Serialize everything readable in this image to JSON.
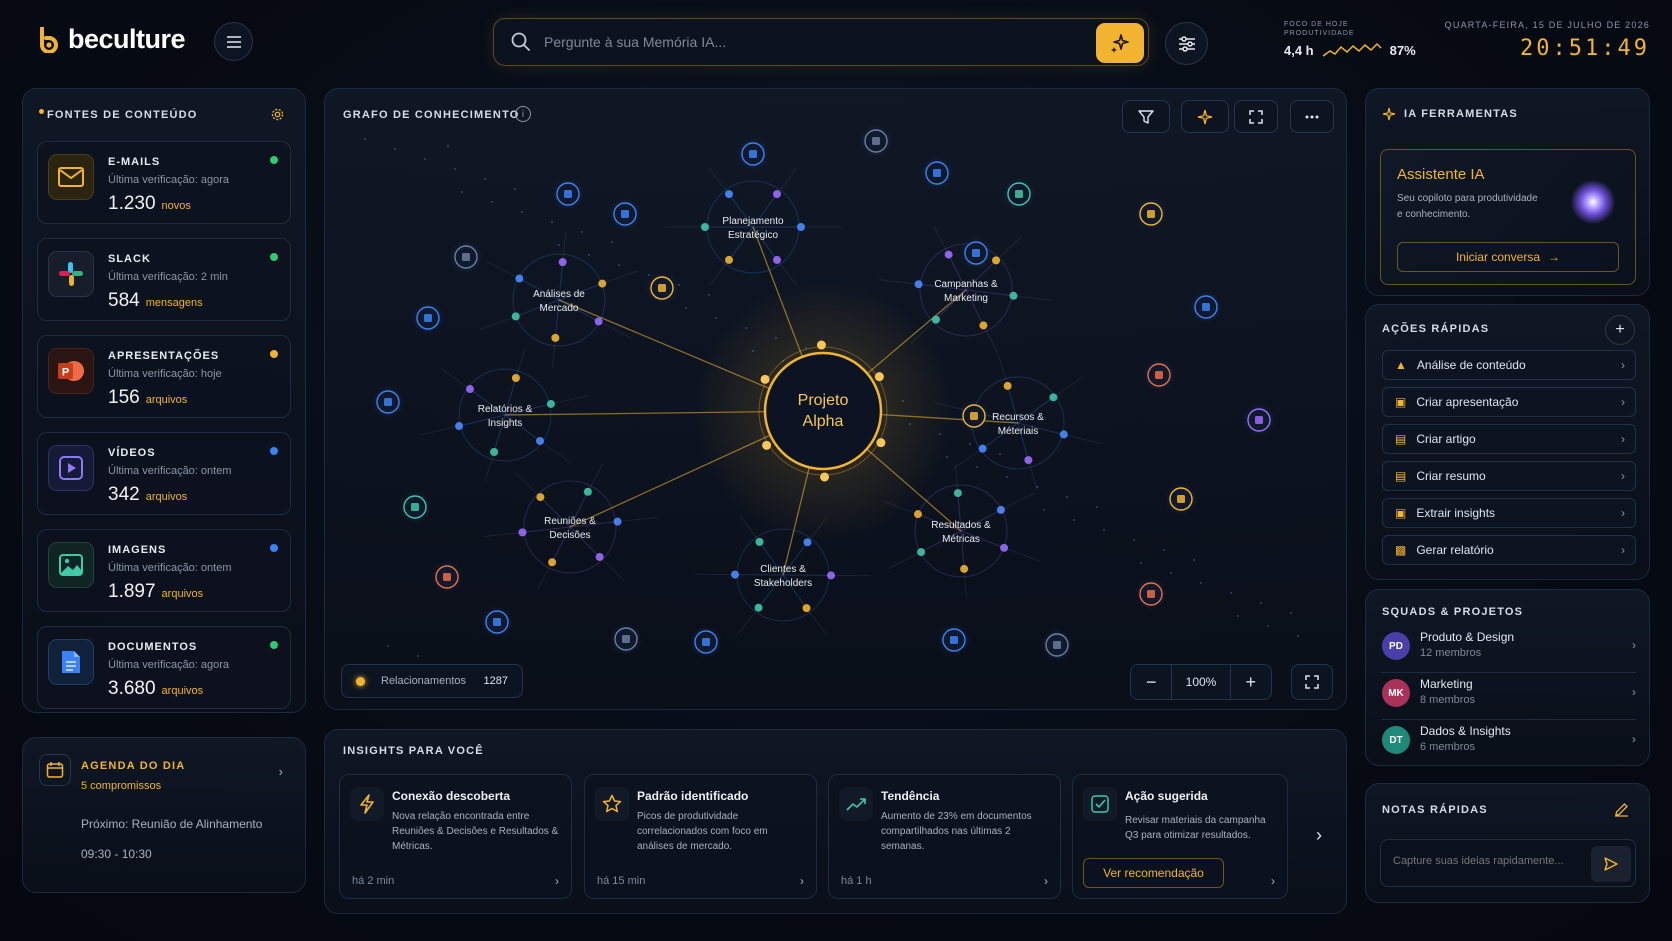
{
  "brand": {
    "name": "beculture"
  },
  "search": {
    "placeholder": "Pergunte à sua Memória IA..."
  },
  "focus": {
    "label_line1": "FOCO DE HOJE",
    "label_line2": "PRODUTIVIDADE",
    "hours": "4,4 h",
    "percent": "87%"
  },
  "datetime": {
    "date": "QUARTA-FEIRA, 15 DE JULHO DE 2026",
    "time": "20:51:49"
  },
  "sources": {
    "title": "FONTES DE CONTEÚDO",
    "items": [
      {
        "name": "E-MAILS",
        "check": "Última verificação: agora",
        "count": "1.230",
        "unit": "novos",
        "dot": "#2ecc71",
        "icon": "mail-icon"
      },
      {
        "name": "SLACK",
        "check": "Última verificação: 2 min",
        "count": "584",
        "unit": "mensagens",
        "dot": "#2ecc71",
        "icon": "slack-icon"
      },
      {
        "name": "APRESENTAÇÕES",
        "check": "Última verificação: hoje",
        "count": "156",
        "unit": "arquivos",
        "dot": "#f2b430",
        "icon": "powerpoint-icon"
      },
      {
        "name": "VÍDEOS",
        "check": "Última verificação: ontem",
        "count": "342",
        "unit": "arquivos",
        "dot": "#3b82f6",
        "icon": "video-icon"
      },
      {
        "name": "IMAGENS",
        "check": "Última verificação: ontem",
        "count": "1.897",
        "unit": "arquivos",
        "dot": "#3b82f6",
        "icon": "image-icon"
      },
      {
        "name": "DOCUMENTOS",
        "check": "Última verificação: agora",
        "count": "3.680",
        "unit": "arquivos",
        "dot": "#2ecc71",
        "icon": "document-icon"
      }
    ]
  },
  "agenda": {
    "title": "AGENDA DO DIA",
    "count": "5 compromissos",
    "next": "Próximo: Reunião de Alinhamento",
    "time": "09:30 - 10:30"
  },
  "graph": {
    "title": "GRAFO DE CONHECIMENTO",
    "center_line1": "Projeto",
    "center_line2": "Alpha",
    "clusters": [
      {
        "line1": "Planejamento",
        "line2": "Estratégico"
      },
      {
        "line1": "Análises de",
        "line2": "Mercado"
      },
      {
        "line1": "Campanhas &",
        "line2": "Marketing"
      },
      {
        "line1": "Relatórios &",
        "line2": "Insights"
      },
      {
        "line1": "Recursos &",
        "line2": "Méteriais"
      },
      {
        "line1": "Reuniões &",
        "line2": "Decisões"
      },
      {
        "line1": "Resultados &",
        "line2": "Métricas"
      },
      {
        "line1": "Clientes &",
        "line2": "Stakeholders"
      }
    ],
    "relationships_label": "Relacionamentos",
    "relationships_count": "1287",
    "zoom": "100%"
  },
  "insights": {
    "title": "INSIGHTS PARA VOCÊ",
    "cards": [
      {
        "title": "Conexão descoberta",
        "text": "Nova relação encontrada entre Reuniões & Decisões e Resultados & Métricas.",
        "time": "há 2 min",
        "icon": "lightning-icon"
      },
      {
        "title": "Padrão identificado",
        "text": "Picos de produtividade correlacionados com foco em análises de mercado.",
        "time": "há 15 min",
        "icon": "star-icon"
      },
      {
        "title": "Tendência",
        "text": "Aumento de 23% em documentos compartilhados nas últimas 2 semanas.",
        "time": "há 1 h",
        "icon": "trend-icon"
      },
      {
        "title": "Ação sugerida",
        "text": "Revisar materiais da campanha Q3 para otimizar resultados.",
        "button": "Ver recomendação",
        "icon": "check-icon"
      }
    ]
  },
  "ai_tools": {
    "title": "IA FERRAMENTAS",
    "assistant_title": "Assistente IA",
    "assistant_desc_line1": "Seu copiloto para produtividade",
    "assistant_desc_line2": "e conhecimento.",
    "assistant_button": "Iniciar conversa"
  },
  "quick_actions": {
    "title": "AÇÕES RÁPIDAS",
    "items": [
      "Análise de conteúdo",
      "Criar apresentação",
      "Criar artigo",
      "Criar resumo",
      "Extrair insights",
      "Gerar relatório"
    ]
  },
  "squads": {
    "title": "SQUADS & PROJETOS",
    "items": [
      {
        "initials": "PD",
        "name": "Produto & Design",
        "members": "12 membros",
        "color": "#4a3fa8"
      },
      {
        "initials": "MK",
        "name": "Marketing",
        "members": "8 membros",
        "color": "#a8325a"
      },
      {
        "initials": "DT",
        "name": "Dados & Insights",
        "members": "6 membros",
        "color": "#1f8a7a"
      }
    ]
  },
  "notes": {
    "title": "NOTAS RÁPIDAS",
    "placeholder": "Capture suas ideias rapidamente..."
  }
}
